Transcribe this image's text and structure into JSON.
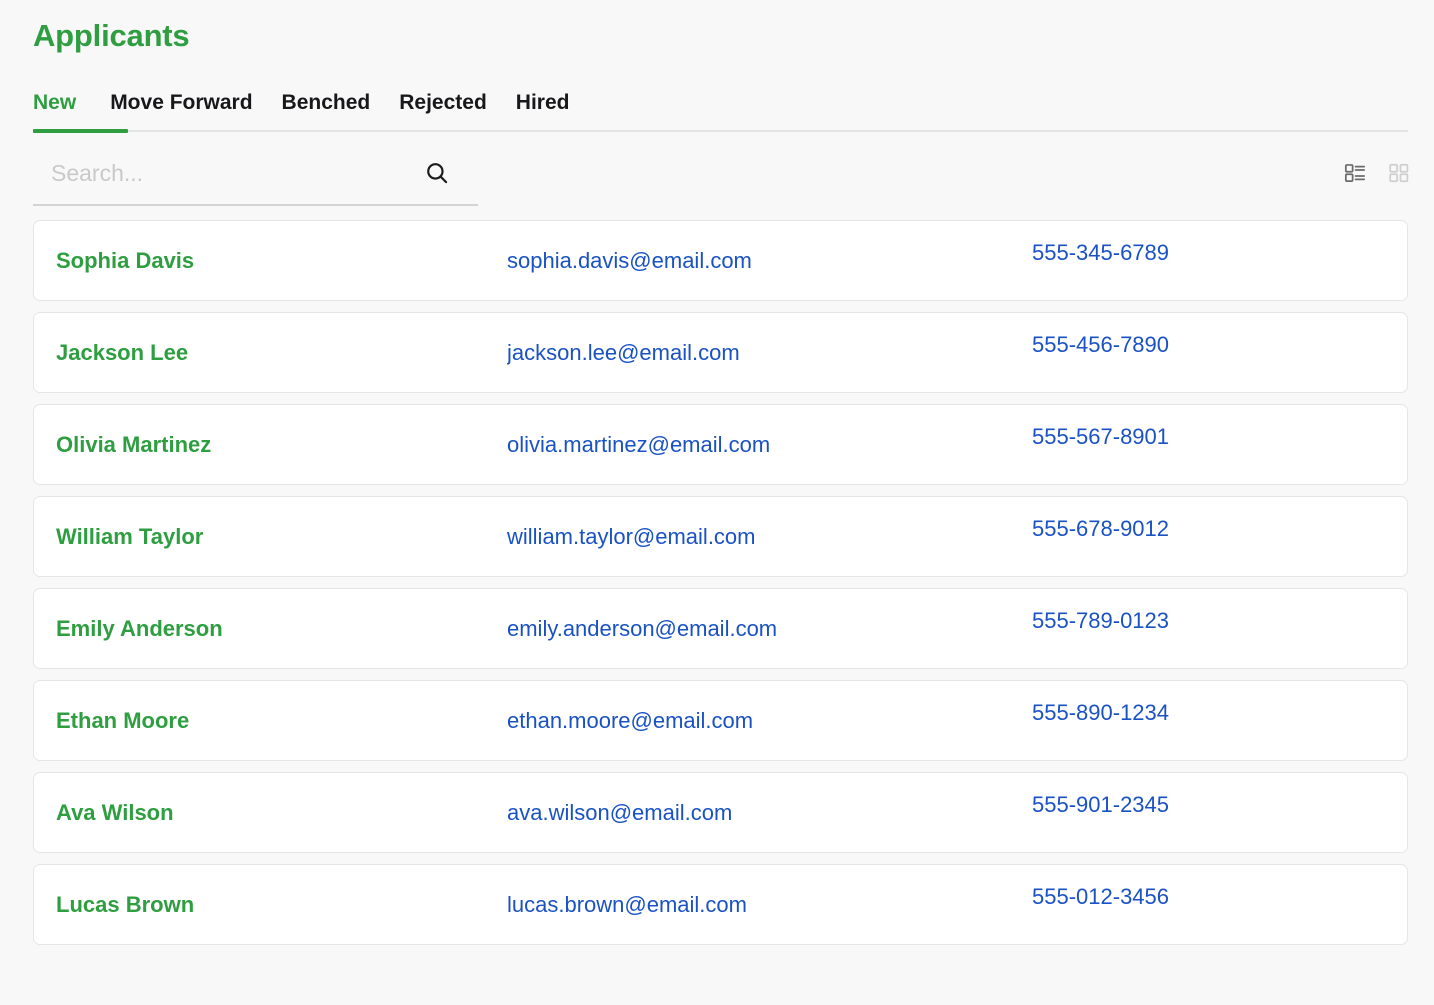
{
  "header": {
    "title": "Applicants"
  },
  "tabs": [
    {
      "label": "New",
      "active": true
    },
    {
      "label": "Move Forward",
      "active": false
    },
    {
      "label": "Benched",
      "active": false
    },
    {
      "label": "Rejected",
      "active": false
    },
    {
      "label": "Hired",
      "active": false
    }
  ],
  "toolbar": {
    "search_placeholder": "Search...",
    "search_value": "",
    "search_icon": "search-icon",
    "view_list_icon": "list-view-icon",
    "view_grid_icon": "grid-view-icon",
    "active_view": "list"
  },
  "colors": {
    "accent_green": "#2e9e41",
    "link_blue": "#1a52c4",
    "page_background": "#f8f8f8",
    "card_background": "#ffffff",
    "card_border": "#e6e6e6",
    "rule": "#e4e4e4",
    "placeholder": "#c9c9c9"
  },
  "applicants": [
    {
      "name": "Sophia Davis",
      "email": "sophia.davis@email.com",
      "phone": "555-345-6789"
    },
    {
      "name": "Jackson Lee",
      "email": "jackson.lee@email.com",
      "phone": "555-456-7890"
    },
    {
      "name": "Olivia Martinez",
      "email": "olivia.martinez@email.com",
      "phone": "555-567-8901"
    },
    {
      "name": "William Taylor",
      "email": "william.taylor@email.com",
      "phone": "555-678-9012"
    },
    {
      "name": "Emily Anderson",
      "email": "emily.anderson@email.com",
      "phone": "555-789-0123"
    },
    {
      "name": "Ethan Moore",
      "email": "ethan.moore@email.com",
      "phone": "555-890-1234"
    },
    {
      "name": "Ava Wilson",
      "email": "ava.wilson@email.com",
      "phone": "555-901-2345"
    },
    {
      "name": "Lucas Brown",
      "email": "lucas.brown@email.com",
      "phone": "555-012-3456"
    }
  ]
}
